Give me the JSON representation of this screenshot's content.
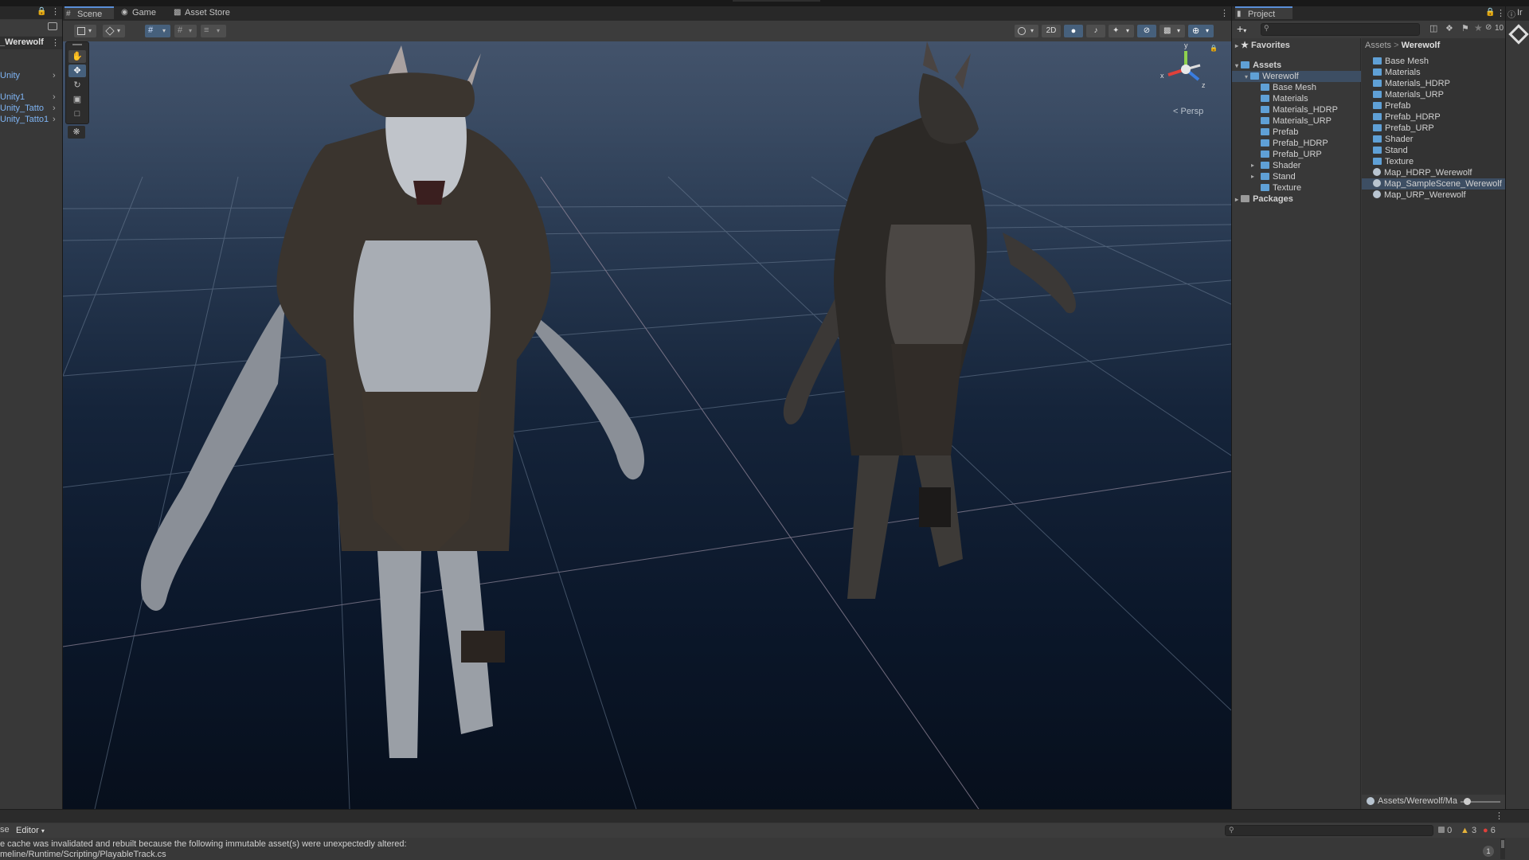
{
  "hierarchy": {
    "scene_name": "_Werewolf",
    "items": [
      "Unity",
      "Unity1",
      "Unity_Tatto",
      "Unity_Tatto1"
    ]
  },
  "scene_tabs": {
    "scene": "Scene",
    "game": "Game",
    "asset_store": "Asset Store"
  },
  "scene_toolbar": {
    "mode_2d": "2D"
  },
  "gizmo": {
    "persp_label": "< Persp",
    "axis_y": "y",
    "axis_x": "x",
    "axis_z": "z"
  },
  "project": {
    "tab_title": "Project",
    "inspector_tab_fragment": "Ir",
    "hidden_count": "10",
    "favorites": "Favorites",
    "assets": "Assets",
    "tree": {
      "werewolf": "Werewolf",
      "children": [
        "Base Mesh",
        "Materials",
        "Materials_HDRP",
        "Materials_URP",
        "Prefab",
        "Prefab_HDRP",
        "Prefab_URP",
        "Shader",
        "Stand",
        "Texture"
      ]
    },
    "packages": "Packages",
    "breadcrumb": {
      "root": "Assets",
      "sep": ">",
      "current": "Werewolf"
    },
    "content_folders": [
      "Base Mesh",
      "Materials",
      "Materials_HDRP",
      "Materials_URP",
      "Prefab",
      "Prefab_HDRP",
      "Prefab_URP",
      "Shader",
      "Stand",
      "Texture"
    ],
    "content_scenes": [
      "Map_HDRP_Werewolf",
      "Map_SampleScene_Werewolf",
      "Map_URP_Werewolf"
    ],
    "selected_scene": "Map_SampleScene_Werewolf",
    "footer_path": "Assets/Werewolf/Ma"
  },
  "console": {
    "tab_fragment": "se",
    "editor_dropdown": "Editor",
    "counts": {
      "info": "0",
      "warnings": "3",
      "errors": "6"
    },
    "messages": [
      "e cache was invalidated and rebuilt because the following immutable asset(s) were unexpectedly altered:",
      "meline/Runtime/Scripting/PlayableTrack.cs"
    ],
    "badge": "1"
  },
  "colors": {
    "accent_blue": "#5a8fd8",
    "link_blue": "#7eb3f2",
    "panel_bg": "#383838",
    "scene_sky": "#455a76",
    "scene_floor": "#0c1a2e",
    "warning": "#e5b23a",
    "error": "#e0403a"
  }
}
